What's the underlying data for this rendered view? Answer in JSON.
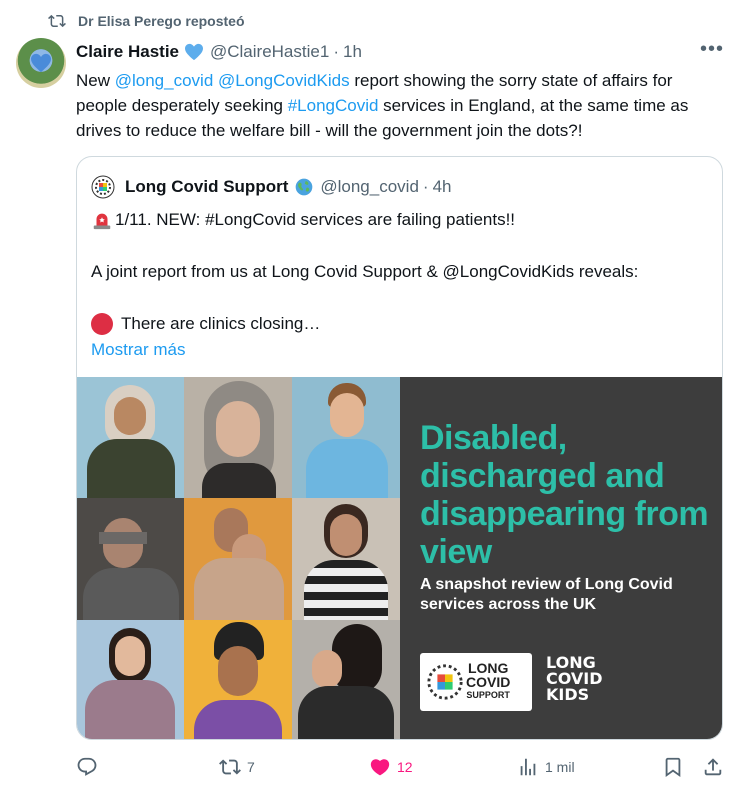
{
  "repost": {
    "label": "Dr Elisa Perego reposteó",
    "icon": "repost-icon"
  },
  "post": {
    "author_name": "Claire Hastie",
    "handle": "@ClaireHastie1",
    "separator": "·",
    "time": "1h",
    "more": "•••",
    "text_parts": {
      "p1": "New ",
      "m1": "@long_covid",
      "p2": " ",
      "m2": "@LongCovidKids",
      "p3": " report showing the sorry state of affairs for people desperately seeking ",
      "h1": "#LongCovid",
      "p4": " services in England, at the same time as drives to reduce the welfare bill - will the government join the dots?!"
    }
  },
  "quote": {
    "author_name": "Long Covid Support",
    "handle": "@long_covid",
    "separator": "·",
    "time": "4h",
    "line1": "1/11. NEW: #LongCovid services are failing patients!!",
    "line2": "A joint report from us at Long Covid Support & @LongCovidKids reveals:",
    "line3": "There are clinics closing…",
    "show_more": "Mostrar más",
    "media": {
      "title": "Disabled, discharged and disappearing from view",
      "subtitle": "A snapshot review of Long Covid services across the UK",
      "logo1": [
        "LONG",
        "COVID",
        "SUPPORT"
      ],
      "logo2": [
        "LONG",
        "COVID",
        "KIDS"
      ]
    }
  },
  "actions": {
    "reply": {
      "icon": "reply-icon",
      "count": ""
    },
    "repost": {
      "icon": "repost-icon",
      "count": "7"
    },
    "like": {
      "icon": "heart-icon",
      "count": "12",
      "color": "#f91880"
    },
    "views": {
      "icon": "views-icon",
      "count": "1 mil"
    },
    "bookmark": {
      "icon": "bookmark-icon"
    },
    "share": {
      "icon": "share-icon"
    }
  },
  "colors": {
    "link": "#1d9bf0",
    "muted": "#536471",
    "accent_teal": "#2dbfa8"
  }
}
